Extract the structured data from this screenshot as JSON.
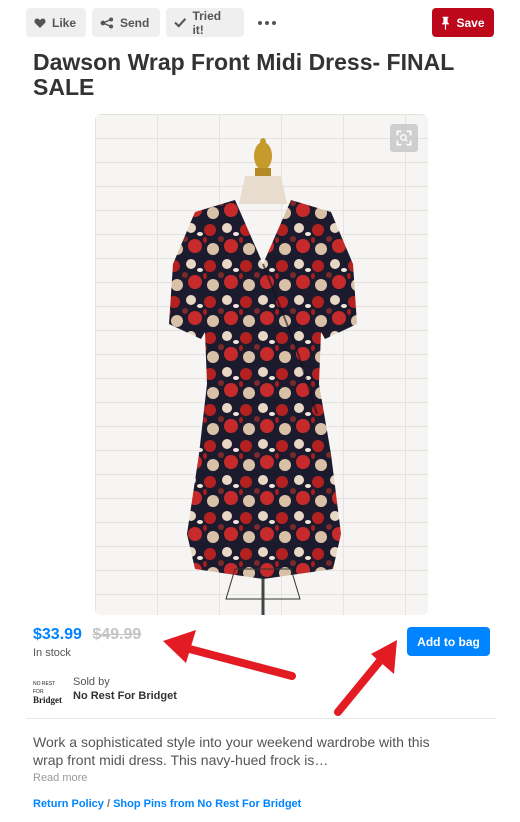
{
  "toolbar": {
    "like_label": "Like",
    "send_label": "Send",
    "tried_label": "Tried it!",
    "save_label": "Save"
  },
  "product": {
    "title": "Dawson Wrap Front Midi Dress- FINAL SALE",
    "price": "$33.99",
    "old_price": "$49.99",
    "stock": "In stock",
    "add_to_bag_label": "Add to bag"
  },
  "seller": {
    "logo_small": "NO REST FOR",
    "logo_large": "Bridget",
    "sold_by_label": "Sold by",
    "name": "No Rest For Bridget"
  },
  "description": {
    "text": "Work a sophisticated style into your weekend wardrobe with this wrap front midi dress. This navy-hued frock is…",
    "read_more": "Read more"
  },
  "links": {
    "return_policy": "Return Policy",
    "separator": "/",
    "shop_pins": "Shop Pins from No Rest For Bridget"
  },
  "colors": {
    "save_red": "#bd081c",
    "accent_blue": "#0084ff",
    "annotation_red": "#e31b23"
  },
  "icons": [
    "heart-icon",
    "share-icon",
    "check-icon",
    "more-icon",
    "pin-icon",
    "zoom-icon"
  ]
}
